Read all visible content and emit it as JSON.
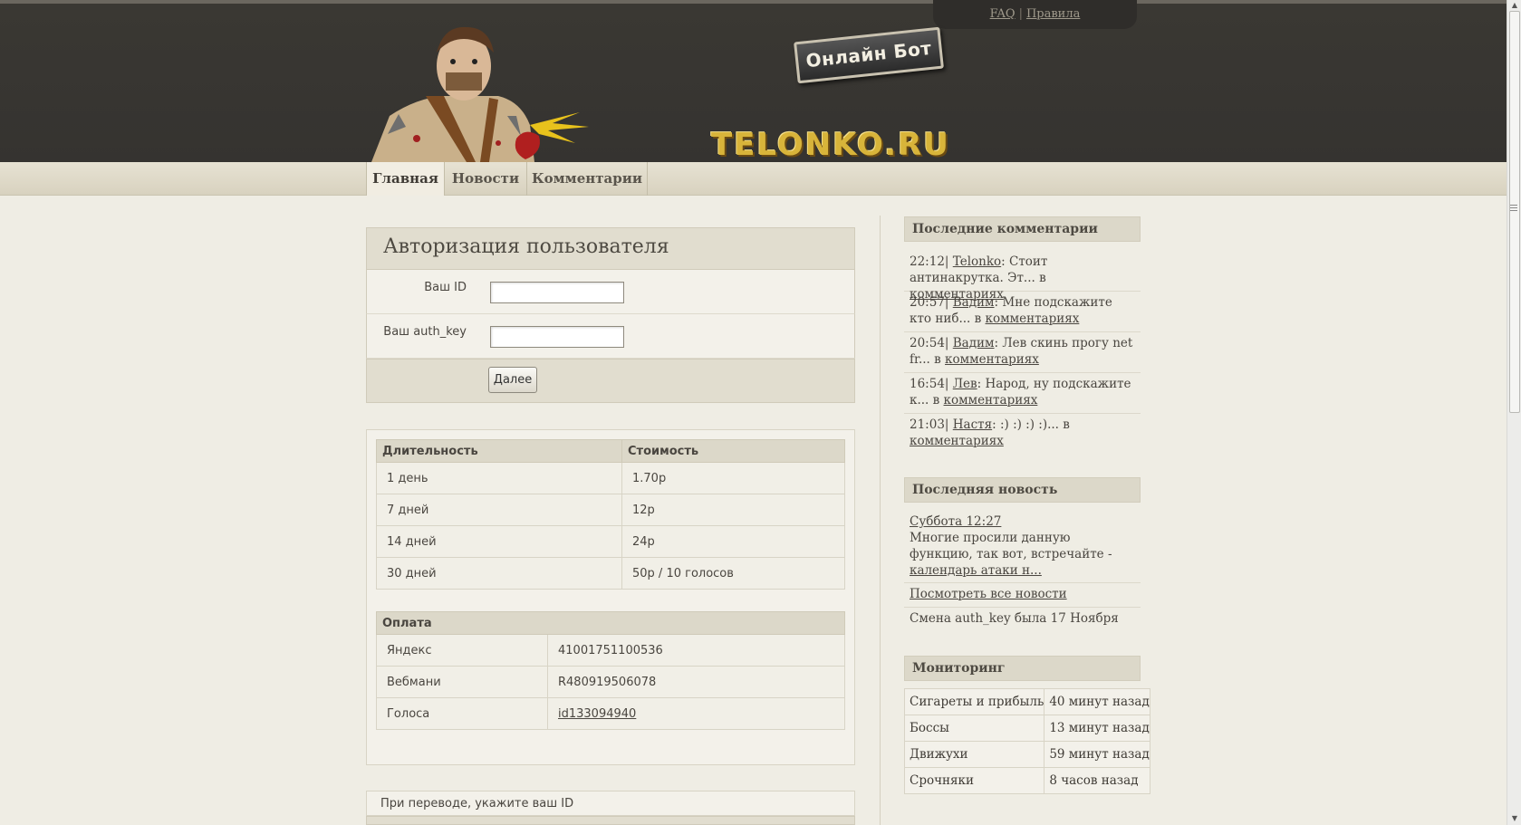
{
  "toplinks": {
    "faq": "FAQ",
    "sep": "|",
    "rules": "Правила"
  },
  "header": {
    "bot_badge": "Онлайн Бот",
    "logo": "TELONKO.RU"
  },
  "nav": {
    "tabs": [
      {
        "label": "Главная"
      },
      {
        "label": "Новости"
      },
      {
        "label": "Комментарии"
      }
    ]
  },
  "auth": {
    "title": "Авторизация пользователя",
    "id_label": "Ваш ID",
    "key_label": "Ваш auth_key",
    "id_value": "",
    "key_value": "",
    "submit": "Далее"
  },
  "prices": {
    "headers": [
      "Длительность",
      "Стоимость"
    ],
    "rows": [
      [
        "1 день",
        "1.70р"
      ],
      [
        "7 дней",
        "12р"
      ],
      [
        "14 дней",
        "24р"
      ],
      [
        "30 дней",
        "50р / 10 голосов"
      ]
    ]
  },
  "payment": {
    "title": "Оплата",
    "rows": [
      {
        "method": "Яндекс",
        "value": "41001751100536"
      },
      {
        "method": "Вебмани",
        "value": "R480919506078"
      },
      {
        "method": "Голоса",
        "value": "id133094940"
      }
    ]
  },
  "note": "При переводе, укажите ваш ID",
  "sidebar": {
    "comments_title": "Последние комментарии",
    "comments": [
      {
        "time": "22:12|",
        "user": "Telonko",
        "text": ": Стоит антинакрутка. Эт... в",
        "link": "комментариях"
      },
      {
        "time": "20:57|",
        "user": "Вадим",
        "text": ": Мне подскажите кто ниб... в",
        "link": "комментариях"
      },
      {
        "time": "20:54|",
        "user": "Вадим",
        "text": ": Лев скинь прогу net fr... в",
        "link": "комментариях"
      },
      {
        "time": "16:54|",
        "user": "Лев",
        "text": ": Народ, ну подскажите к... в",
        "link": "комментариях"
      },
      {
        "time": "21:03|",
        "user": "Настя",
        "text": ": :) :) :) :)... в",
        "link": "комментариях"
      }
    ],
    "news_title": "Последняя новость",
    "news_date": "Суббота 12:27",
    "news_text": "Многие просили данную функцию, так вот, встречайте - ",
    "news_link": "календарь атаки н...",
    "all_news": "Посмотреть все новости",
    "authkey_change": "Смена auth_key была 17 Ноября",
    "monitor_title": "Мониторинг",
    "monitor": [
      [
        "Сигареты и прибыль",
        "40 минут назад"
      ],
      [
        "Боссы",
        "13 минут назад"
      ],
      [
        "Движухи",
        "59 минут назад"
      ],
      [
        "Срочняки",
        "8 часов назад"
      ]
    ]
  }
}
